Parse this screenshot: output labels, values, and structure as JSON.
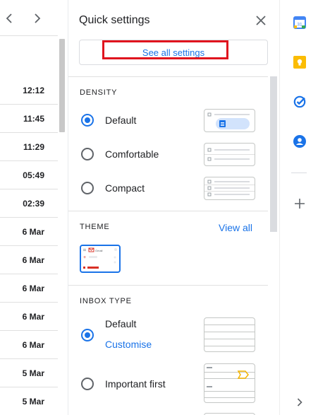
{
  "mail_list": {
    "times": [
      "12:12",
      "11:45",
      "11:29",
      "05:49",
      "02:39",
      "6 Mar",
      "6 Mar",
      "6 Mar",
      "6 Mar",
      "6 Mar",
      "5 Mar",
      "5 Mar"
    ]
  },
  "quick_settings": {
    "title": "Quick settings",
    "see_all_label": "See all settings",
    "density": {
      "heading": "DENSITY",
      "options": [
        "Default",
        "Comfortable",
        "Compact"
      ],
      "selected": "Default"
    },
    "theme": {
      "heading": "THEME",
      "view_all_label": "View all",
      "thumb_brand": "Gmail"
    },
    "inbox_type": {
      "heading": "INBOX TYPE",
      "options": [
        "Default",
        "Important first"
      ],
      "customise_label": "Customise",
      "selected": "Default"
    }
  },
  "side_rail": {
    "icons": [
      "calendar-icon",
      "keep-icon",
      "tasks-icon",
      "contacts-icon",
      "add-icon",
      "expand-icon"
    ],
    "calendar_day": "31"
  },
  "colors": {
    "accent": "#1a73e8",
    "highlight_box": "#e0141e",
    "keep_yellow": "#fbbc04",
    "important_marker": "#f4b400"
  }
}
